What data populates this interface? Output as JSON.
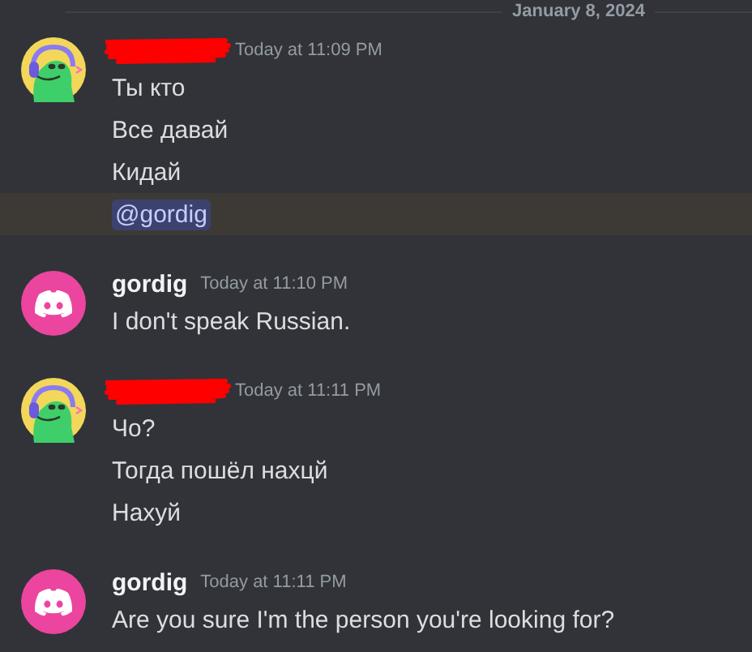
{
  "date_divider": "January 8, 2024",
  "messages": [
    {
      "kind": "character",
      "author": {
        "name_redacted": true
      },
      "timestamp": "Today at 11:09 PM",
      "lines": [
        {
          "kind": "text",
          "text": "Ты кто",
          "highlighted": false
        },
        {
          "kind": "text",
          "text": "Все давай",
          "highlighted": false
        },
        {
          "kind": "text",
          "text": "Кидай",
          "highlighted": false
        },
        {
          "kind": "mention",
          "text": "@gordig",
          "highlighted": true
        }
      ]
    },
    {
      "kind": "discord",
      "author": {
        "name": "gordig",
        "name_redacted": false
      },
      "timestamp": "Today at 11:10 PM",
      "lines": [
        {
          "kind": "text",
          "text": "I don't speak Russian.",
          "highlighted": false
        }
      ]
    },
    {
      "kind": "character",
      "author": {
        "name_redacted": true
      },
      "timestamp": "Today at 11:11 PM",
      "lines": [
        {
          "kind": "text",
          "text": "Чо?",
          "highlighted": false
        },
        {
          "kind": "text",
          "text": "Тогда пошёл нахцй",
          "highlighted": false
        },
        {
          "kind": "text",
          "text": "Нахуй",
          "highlighted": false
        }
      ]
    },
    {
      "kind": "discord",
      "author": {
        "name": "gordig",
        "name_redacted": false
      },
      "timestamp": "Today at 11:11 PM",
      "lines": [
        {
          "kind": "text",
          "text": "Are you sure I'm the person you're looking for?",
          "highlighted": false
        }
      ]
    }
  ]
}
